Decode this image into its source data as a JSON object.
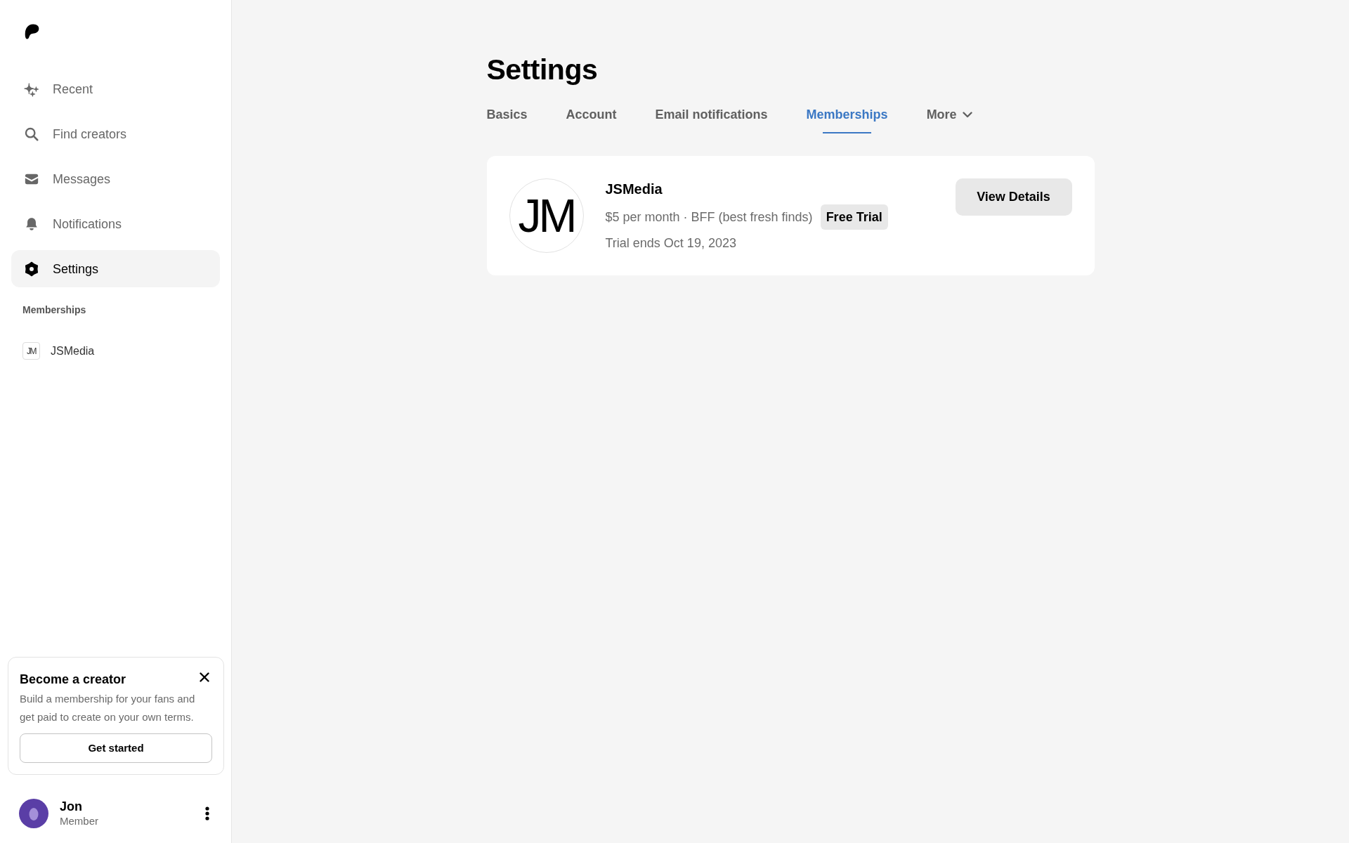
{
  "sidebar": {
    "nav": [
      {
        "label": "Recent",
        "selected": false
      },
      {
        "label": "Find creators",
        "selected": false
      },
      {
        "label": "Messages",
        "selected": false
      },
      {
        "label": "Notifications",
        "selected": false
      },
      {
        "label": "Settings",
        "selected": true
      }
    ],
    "memberships_heading": "Memberships",
    "memberships": [
      {
        "avatar_text": "JM",
        "name": "JSMedia"
      }
    ],
    "promo": {
      "title": "Become a creator",
      "text": "Build a membership for your fans and get paid to create on your own terms.",
      "button": "Get started"
    },
    "user": {
      "name": "Jon",
      "role": "Member"
    }
  },
  "main": {
    "title": "Settings",
    "tabs": [
      {
        "label": "Basics",
        "kind": "tab",
        "selected": false
      },
      {
        "label": "Account",
        "kind": "tab",
        "selected": false
      },
      {
        "label": "Email notifications",
        "kind": "tab",
        "selected": false
      },
      {
        "label": "Memberships",
        "kind": "tab",
        "selected": true
      },
      {
        "label": "More",
        "kind": "dropdown",
        "selected": false
      }
    ],
    "memberships": [
      {
        "avatar_text": "JM",
        "name": "JSMedia",
        "details": "$5 per month · BFF (best fresh finds)",
        "badge": "Free Trial",
        "trial_end": "Trial ends Oct 19, 2023",
        "button": "View Details"
      }
    ]
  }
}
